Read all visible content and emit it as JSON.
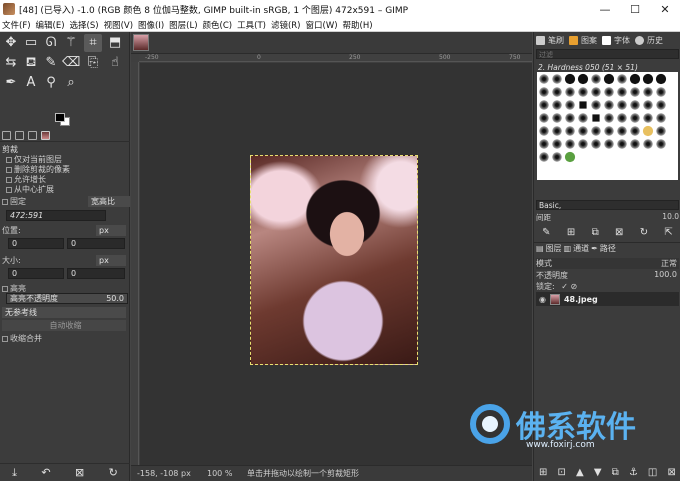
{
  "window": {
    "title": "[48] (已导入) -1.0 (RGB 颜色 8 位伽马整数, GIMP built-in sRGB, 1 个图层) 472x591 – GIMP",
    "minimize": "—",
    "maximize": "☐",
    "close": "✕"
  },
  "menu": [
    "文件(F)",
    "编辑(E)",
    "选择(S)",
    "视图(V)",
    "图像(I)",
    "图层(L)",
    "颜色(C)",
    "工具(T)",
    "滤镜(R)",
    "窗口(W)",
    "帮助(H)"
  ],
  "tool_options": {
    "title": "剪裁",
    "opt1": "仅对当前图层",
    "opt2": "删除剪裁的像素",
    "opt3": "允许增长",
    "opt4": "从中心扩展",
    "fixed_label": "固定",
    "fixed_value": "宽高比",
    "ratio": "472:591",
    "position_label": "位置:",
    "position_unit": "px",
    "position_x": "0",
    "position_y": "0",
    "size_label": "大小:",
    "size_unit": "px",
    "size_w": "0",
    "size_h": "0",
    "highlight_label": "高亮",
    "highlight_opacity_label": "高亮不透明度",
    "highlight_opacity_value": "50.0",
    "guides": "无参考线",
    "auto_shrink": "自动收缩",
    "merge_label": "收缩合并"
  },
  "canvas": {
    "ruler_marks": [
      "-250",
      "0",
      "250",
      "500",
      "750"
    ]
  },
  "status": {
    "coords": "-158, -108",
    "unit": "px",
    "zoom": "100 %",
    "message": "单击并拖动以绘制一个剪裁矩形"
  },
  "brushes_panel": {
    "tab_brushes": "笔刷",
    "tab_patterns": "图案",
    "tab_fonts": "字体",
    "tab_history": "历史",
    "filter_placeholder": "过滤",
    "current_brush": "2. Hardness 050 (51 × 51)",
    "tag": "Basic,",
    "spacing_label": "间距",
    "spacing_value": "10.0"
  },
  "layers_panel": {
    "tab_layers": "图层",
    "tab_channels": "通道",
    "tab_paths": "路径",
    "mode_label": "模式",
    "mode_value": "正常",
    "opacity_label": "不透明度",
    "opacity_value": "100.0",
    "lock_label": "锁定:",
    "layer_name": "48.jpeg"
  },
  "watermark": {
    "title": "佛系软件",
    "url": "www.foxirj.com"
  },
  "colors": {
    "fg": "#000000",
    "bg": "#ffffff",
    "selection": "#e8e070",
    "watermark": "#5bb2f0"
  }
}
